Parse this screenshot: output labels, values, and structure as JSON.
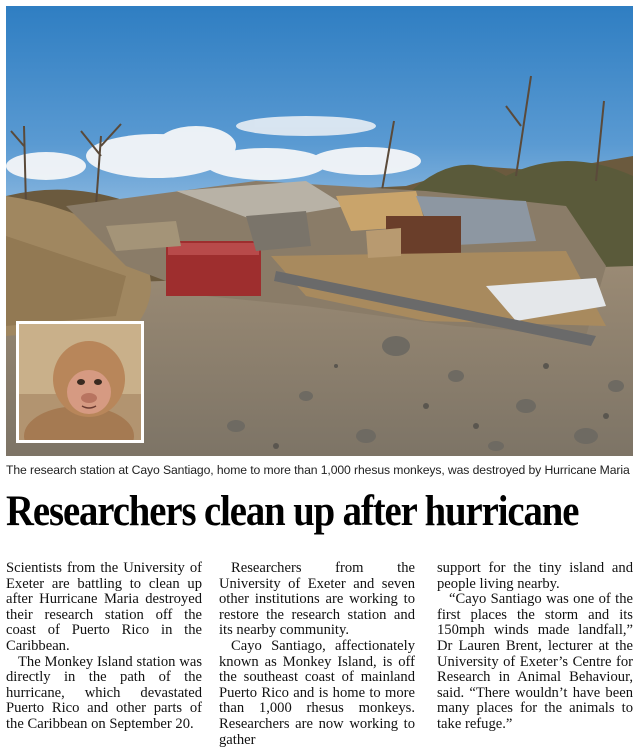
{
  "photo": {
    "main_alt": "Destroyed research station debris on rocky ground under blue sky",
    "inset_alt": "Rhesus monkey"
  },
  "caption": "The research station at Cayo Santiago, home to more than 1,000 rhesus monkeys, was destroyed by Hurricane Maria",
  "headline": "Researchers clean up after hurricane",
  "columns": [
    [
      "Scientists from the University of Exeter are battling to clean up after Hurricane Maria destroyed their research station off the coast of Puerto Rico in the Caribbean.",
      "The Monkey Island station was directly in the path of the hurricane, which devastated Puerto Rico and other parts of the Caribbean on September 20."
    ],
    [
      "Researchers from the University of Exeter and seven other institutions are working to restore the research station and its nearby community.",
      "Cayo Santiago, affectionately known as Monkey Island, is off the southeast coast of mainland Puerto Rico and is home to more than 1,000 rhesus monkeys. Researchers are now working to gather"
    ],
    [
      "support for the tiny island and people living nearby.",
      "“Cayo Santiago was one of the first places the storm and its 150mph winds made landfall,” Dr Lauren Brent, lecturer at the University of Exeter’s Centre for Research in Animal Behaviour, said. “There wouldn’t have been many places for the animals to take refuge.”"
    ]
  ]
}
